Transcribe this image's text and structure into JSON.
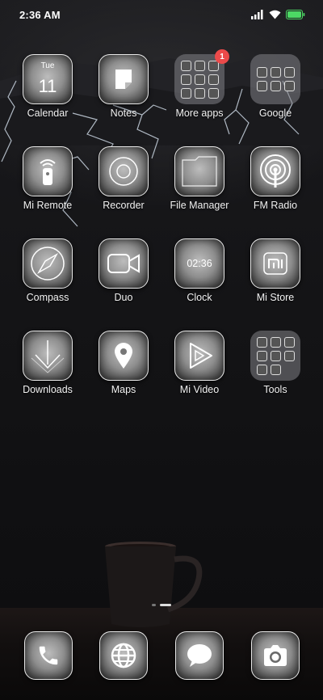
{
  "status_bar": {
    "time": "2:36 AM",
    "icons": [
      "signal-icon",
      "wifi-icon",
      "battery-icon"
    ],
    "battery_color": "#4cd964"
  },
  "apps": [
    {
      "label": "Calendar",
      "icon": "calendar-icon",
      "day": "Tue",
      "date": "11"
    },
    {
      "label": "Notes",
      "icon": "notes-icon"
    },
    {
      "label": "More apps",
      "icon": "folder-icon",
      "badge": "1"
    },
    {
      "label": "Google",
      "icon": "folder-icon"
    },
    {
      "label": "Mi Remote",
      "icon": "remote-icon"
    },
    {
      "label": "Recorder",
      "icon": "recorder-icon"
    },
    {
      "label": "File Manager",
      "icon": "folder-file-icon"
    },
    {
      "label": "FM Radio",
      "icon": "radio-icon"
    },
    {
      "label": "Compass",
      "icon": "compass-icon"
    },
    {
      "label": "Duo",
      "icon": "video-camera-icon"
    },
    {
      "label": "Clock",
      "icon": "clock-icon",
      "time_text": "02:36"
    },
    {
      "label": "Mi Store",
      "icon": "mi-logo-icon"
    },
    {
      "label": "Downloads",
      "icon": "download-arrow-icon"
    },
    {
      "label": "Maps",
      "icon": "map-pin-icon"
    },
    {
      "label": "Mi Video",
      "icon": "play-icon"
    },
    {
      "label": "Tools",
      "icon": "folder-icon"
    }
  ],
  "dock": [
    {
      "icon": "phone-icon"
    },
    {
      "icon": "globe-icon"
    },
    {
      "icon": "chat-icon"
    },
    {
      "icon": "camera-icon"
    }
  ],
  "page_indicator": {
    "pages": 2,
    "active": 2
  },
  "accent_colors": {
    "badge": "#ec4a4a",
    "icon_border": "#e8e8e8"
  }
}
